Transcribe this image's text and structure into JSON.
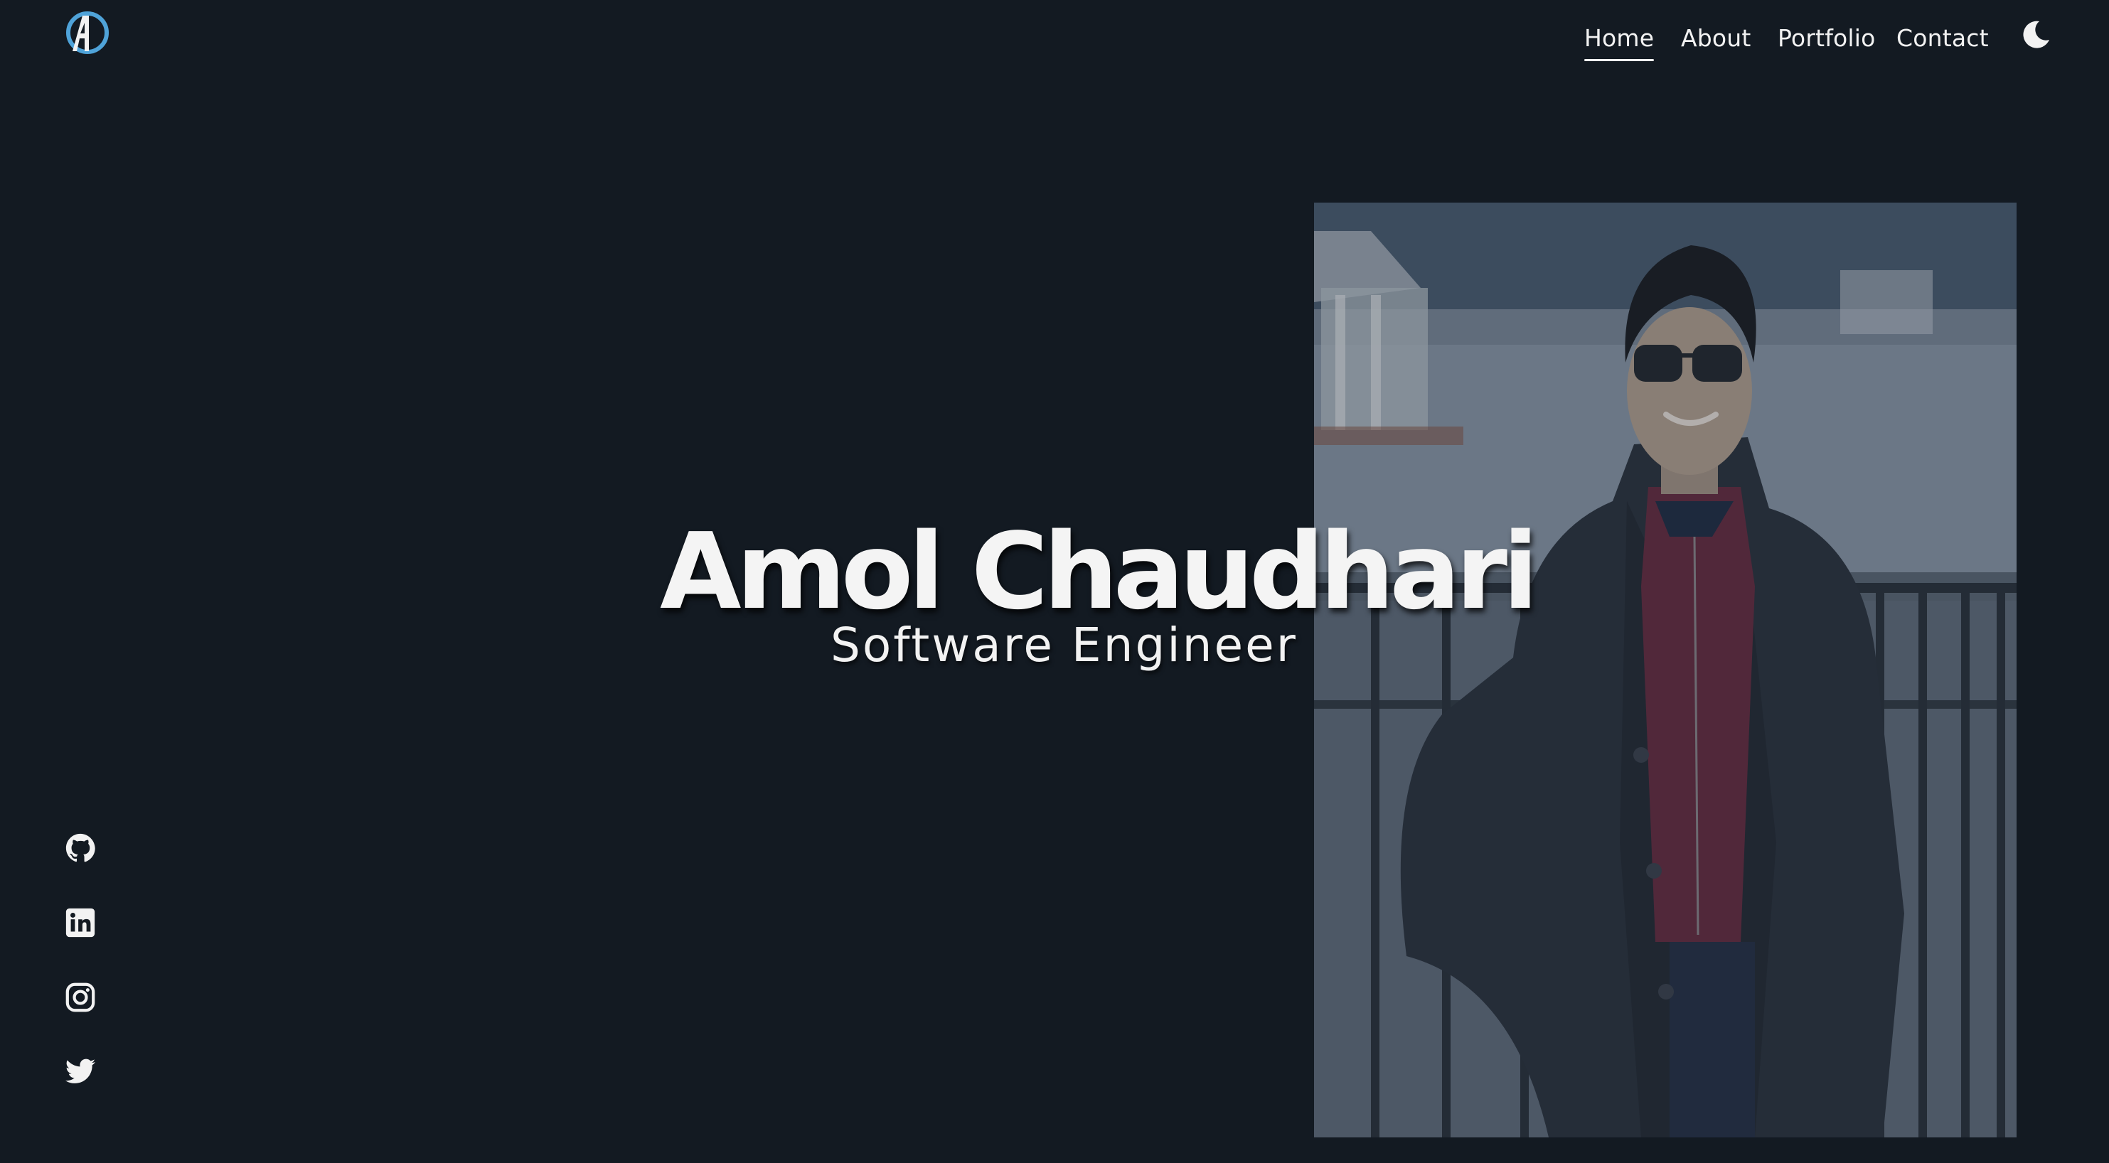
{
  "brand": {
    "logo_icon": "ac-monogram-logo"
  },
  "nav": {
    "items": [
      {
        "label": "Home",
        "active": true
      },
      {
        "label": "About",
        "active": false
      },
      {
        "label": "Portfolio",
        "active": false
      },
      {
        "label": "Contact",
        "active": false
      }
    ],
    "theme_toggle_icon": "moon-icon"
  },
  "hero": {
    "name": "Amol Chaudhari",
    "role": "Software Engineer",
    "photo": "portrait-photo"
  },
  "social": [
    {
      "icon": "github-icon"
    },
    {
      "icon": "linkedin-icon"
    },
    {
      "icon": "instagram-icon"
    },
    {
      "icon": "twitter-icon"
    }
  ],
  "colors": {
    "background": "#131a22",
    "text": "#f2f2f2",
    "logo_accent": "#4fa3d9"
  }
}
